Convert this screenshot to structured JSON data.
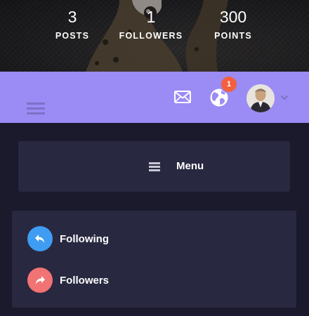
{
  "profile": {
    "stats": [
      {
        "number": "3",
        "label": "POSTS"
      },
      {
        "number": "1",
        "label": "FOLLOWERS"
      },
      {
        "number": "300",
        "label": "POINTS"
      }
    ]
  },
  "header": {
    "notification_count": "1",
    "icons": [
      "hamburger-icon",
      "mail-icon",
      "globe-icon",
      "avatar",
      "chevron-down-icon"
    ]
  },
  "menu": {
    "label": "Menu"
  },
  "follow": {
    "items": [
      {
        "label": "Following",
        "icon": "reply-arrow-icon",
        "color": "#3e9df2"
      },
      {
        "label": "Followers",
        "icon": "share-arrow-icon",
        "color": "#f27373"
      }
    ]
  },
  "colors": {
    "accent": "#9b8bf4",
    "background": "#1a1a2c",
    "card": "#292841",
    "badge": "#f2603f"
  }
}
